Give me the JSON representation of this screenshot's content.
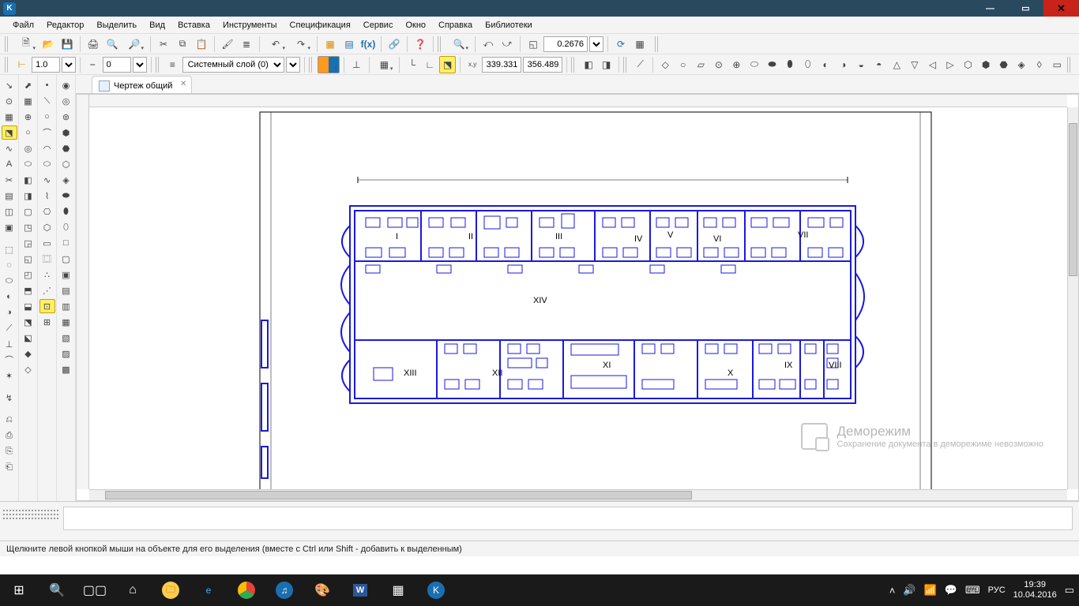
{
  "titlebar": {
    "close": "✕",
    "min": "—",
    "max": "▭"
  },
  "menu": {
    "items": [
      "Файл",
      "Редактор",
      "Выделить",
      "Вид",
      "Вставка",
      "Инструменты",
      "Спецификация",
      "Сервис",
      "Окно",
      "Справка",
      "Библиотеки"
    ]
  },
  "toolbar1": {
    "zoom": "0.2676"
  },
  "toolbar2": {
    "lw": "1.0",
    "step": "0",
    "layer": "Системный слой (0)",
    "x": "339.331",
    "y": "356.489"
  },
  "tab": {
    "title": "Чертеж общий"
  },
  "drawing": {
    "rooms": [
      "I",
      "II",
      "III",
      "IV",
      "V",
      "VI",
      "VII",
      "VIII",
      "IX",
      "X",
      "XI",
      "XII",
      "XIII",
      "XIV"
    ]
  },
  "watermark": {
    "title": "Деморежим",
    "subtitle": "Сохранение документа в деморежиме невозможно"
  },
  "status": {
    "text": "Щелкните левой кнопкой мыши на объекте для его выделения (вместе с Ctrl или Shift - добавить к выделенным)"
  },
  "taskbar": {
    "lang": "РУС",
    "time": "19:39",
    "date": "10.04.2016"
  }
}
